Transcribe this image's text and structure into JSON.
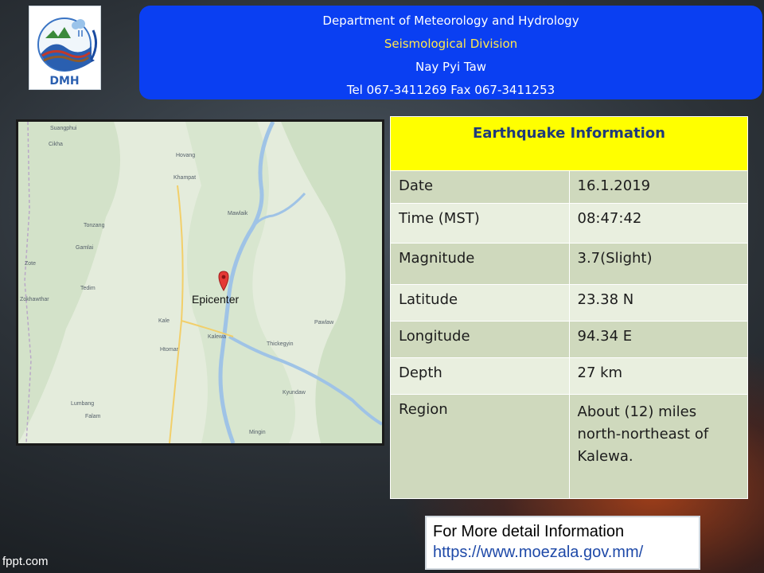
{
  "logo": {
    "text": "DMH"
  },
  "header": {
    "line1": "Department of Meteorology and Hydrology",
    "line2": "Seismological Division",
    "line3": "Nay Pyi Taw",
    "line4": "Tel 067-3411269 Fax 067-3411253"
  },
  "map": {
    "epicenter_label": "Epicenter",
    "places": [
      "Suangphui",
      "Cikha",
      "Hovang",
      "Khampat",
      "Mawlaik",
      "Tonzang",
      "Gamlai",
      "Zote",
      "Tedim",
      "Zokhawthar",
      "Kale",
      "Kalewa",
      "Thickegyin",
      "Pawlaw",
      "Htomar",
      "Kyundaw",
      "Lumbang",
      "Falam",
      "Mingin"
    ]
  },
  "info": {
    "title": "Earthquake Information",
    "rows": [
      {
        "label": "Date",
        "value": "16.1.2019"
      },
      {
        "label": "Time (MST)",
        "value": "08:47:42"
      },
      {
        "label": "Magnitude",
        "value": "3.7(Slight)"
      },
      {
        "label": "Latitude",
        "value": "23.38 N"
      },
      {
        "label": "Longitude",
        "value": "94.34 E"
      },
      {
        "label": "Depth",
        "value": "27 km"
      },
      {
        "label": "Region",
        "value": "About (12) miles north-northeast of Kalewa."
      }
    ]
  },
  "detail": {
    "line1": "For More detail Information",
    "url": "https://www.moezala.gov.mm/"
  },
  "footer": {
    "text": "fppt.com"
  },
  "colors": {
    "header_bg": "#0a3ff2",
    "title_bg": "#ffff00",
    "row_dark": "#cfd9bd",
    "row_light": "#e9efdf"
  }
}
